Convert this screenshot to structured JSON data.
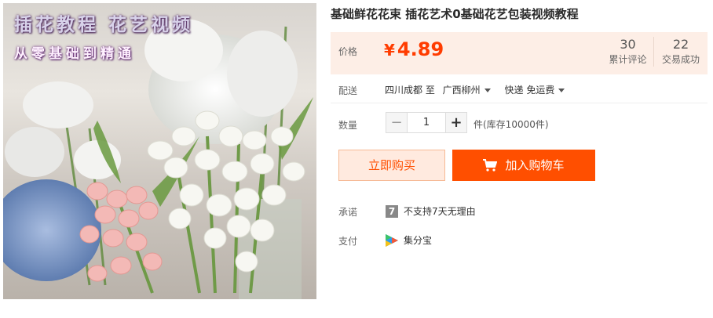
{
  "image": {
    "title": "插花教程 花艺视频",
    "subtitle": "从零基础到精通"
  },
  "product": {
    "title": "基础鲜花花束 插花艺术0基础花艺包装视频教程"
  },
  "price": {
    "label": "价格",
    "currency": "¥",
    "value": "4.89",
    "reviews_count": "30",
    "reviews_label": "累计评论",
    "deals_count": "22",
    "deals_label": "交易成功"
  },
  "delivery": {
    "label": "配送",
    "from": "四川成都 至",
    "to": "广西柳州",
    "method": "快递 免运费"
  },
  "quantity": {
    "label": "数量",
    "minus": "−",
    "value": "1",
    "plus": "+",
    "stock": "件(库存10000件)"
  },
  "buttons": {
    "buy_now": "立即购买",
    "add_to_cart": "加入购物车"
  },
  "promise": {
    "label": "承诺",
    "badge": "7",
    "text": "不支持7天无理由"
  },
  "payment": {
    "label": "支付",
    "method": "集分宝"
  },
  "colors": {
    "accent": "#ff4f00",
    "price": "#ff3c00",
    "price_panel_bg": "#fdeee6"
  }
}
